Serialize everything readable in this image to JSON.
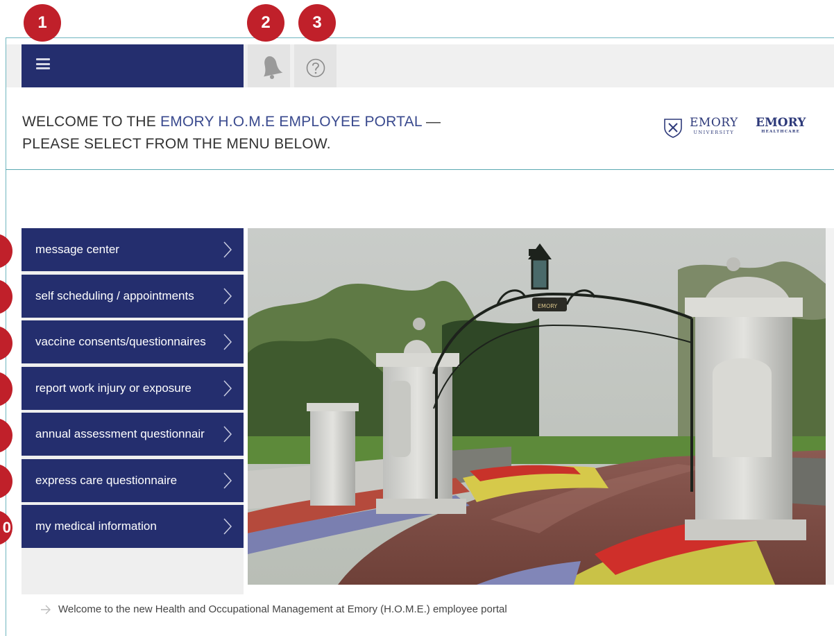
{
  "badges": {
    "b1": "1",
    "b2": "2",
    "b3": "3",
    "b10": "0"
  },
  "toolbar": {
    "menu_icon": "hamburger-menu-icon",
    "notifications_icon": "bell-icon",
    "help_icon": "question-circle-icon"
  },
  "welcome": {
    "prefix": "WELCOME TO THE ",
    "highlight": "EMORY H.O.M.E EMPLOYEE PORTAL",
    "suffix": " —",
    "line2": "PLEASE SELECT FROM THE MENU BELOW."
  },
  "logos": {
    "university_name": "EMORY",
    "university_sub": "UNIVERSITY",
    "healthcare_name": "EMORY",
    "healthcare_sub": "HEALTHCARE"
  },
  "nav": {
    "items": [
      {
        "label": "message center"
      },
      {
        "label": "self scheduling / appointments"
      },
      {
        "label": "vaccine consents/questionnaires"
      },
      {
        "label": "report work injury or exposure"
      },
      {
        "label": "annual assessment questionnair"
      },
      {
        "label": "express care questionnaire"
      },
      {
        "label": "my medical information"
      }
    ]
  },
  "footer": {
    "text": "Welcome to the new Health and Occupational Management at Emory (H.O.M.E.) employee portal"
  },
  "colors": {
    "navy": "#242e6e",
    "badge_red": "#c0202a",
    "accent_teal": "#5aa9b1"
  }
}
